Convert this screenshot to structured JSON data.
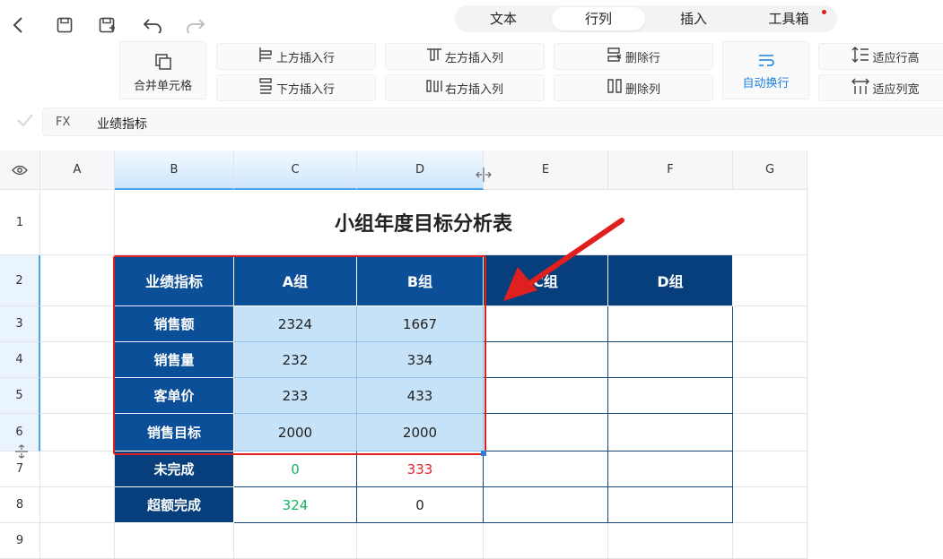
{
  "toolbar": {
    "tabs": [
      {
        "label": "文本"
      },
      {
        "label": "行列"
      },
      {
        "label": "插入"
      },
      {
        "label": "工具箱"
      }
    ],
    "active_tab": "行列",
    "buttons": {
      "merge": "合并单元格",
      "insert_row_above": "上方插入行",
      "insert_row_below": "下方插入行",
      "insert_col_left": "左方插入列",
      "insert_col_right": "右方插入列",
      "delete_row": "删除行",
      "delete_col": "删除列",
      "wrap": "自动换行",
      "fit_row_height": "适应行高",
      "fit_col_width": "适应列宽"
    }
  },
  "formula_bar": {
    "label": "FX",
    "value": "业绩指标"
  },
  "columns": [
    "A",
    "B",
    "C",
    "D",
    "E",
    "F",
    "G"
  ],
  "rows": [
    "1",
    "2",
    "3",
    "4",
    "5",
    "6",
    "7",
    "8",
    "9"
  ],
  "sheet": {
    "title": "小组年度目标分析表",
    "headers": [
      "业绩指标",
      "A组",
      "B组",
      "C组",
      "D组"
    ],
    "rows": [
      {
        "label": "销售额",
        "a": "2324",
        "b": "1667"
      },
      {
        "label": "销售量",
        "a": "232",
        "b": "334"
      },
      {
        "label": "客单价",
        "a": "233",
        "b": "433"
      },
      {
        "label": "销售目标",
        "a": "2000",
        "b": "2000"
      },
      {
        "label": "未完成",
        "a": "0",
        "b": "333"
      },
      {
        "label": "超额完成",
        "a": "324",
        "b": "0"
      }
    ]
  },
  "colors": {
    "header_blue": "#0b4f99",
    "selection_fill": "#c6e2f8",
    "annotation_red": "#e0201f",
    "positive_green": "#12b560"
  }
}
